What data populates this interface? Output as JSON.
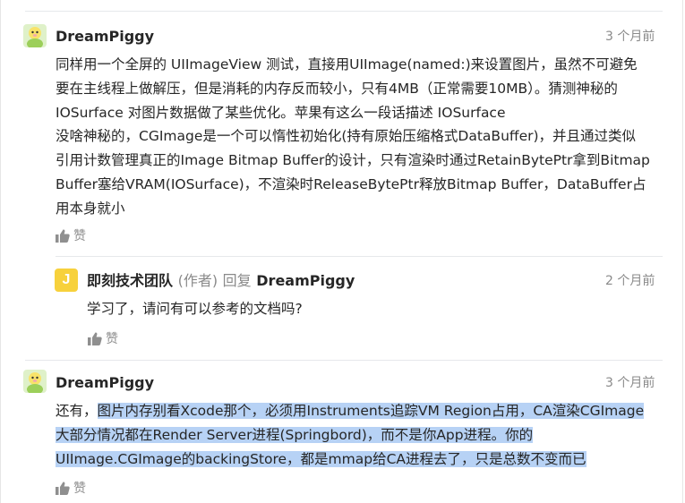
{
  "comments": [
    {
      "user": "DreamPiggy",
      "time": "3 个月前",
      "lines": [
        "同样用一个全屏的 UIImageView 测试，直接用UIImage(named:)来设置图片，虽然不可避免",
        "要在主线程上做解压，但是消耗的内存反而较小，只有4MB（正常需要10MB）。猜测神秘的",
        "IOSurface 对图片数据做了某些优化。苹果有这么一段话描述 IOSurface",
        "没啥神秘的，CGImage是一个可以惰性初始化(持有原始压缩格式DataBuffer)，并且通过类似",
        "引用计数管理真正的Image Bitmap Buffer的设计，只有渲染时通过RetainBytePtr拿到Bitmap",
        "Buffer塞给VRAM(IOSurface)，不渲染时ReleaseBytePtr释放Bitmap Buffer，DataBuffer占",
        "用本身就小"
      ],
      "like_label": "赞"
    },
    {
      "user": "即刻技术团队",
      "author_tag": "(作者)",
      "reply_label": "回复",
      "reply_to": "DreamPiggy",
      "avatar_letter": "J",
      "time": "2 个月前",
      "text": "学习了，请问有可以参考的文档吗?",
      "like_label": "赞"
    },
    {
      "user": "DreamPiggy",
      "time": "3 个月前",
      "line1_plain": "还有，",
      "line1_hl": "图片内存别看Xcode那个，必须用Instruments追踪VM Region占用，CA渲染CGImage",
      "line2": "大部分情况都在Render Server进程(Springbord)，而不是你App进程。你的",
      "line3": "UIImage.CGImage的backingStore，都是mmap给CA进程去了，只是总数不变而已",
      "like_label": "赞"
    }
  ],
  "colors": {
    "highlight": "#b7d2f5",
    "accent_yellow": "#f7d13c",
    "muted": "#8a8a8a"
  }
}
